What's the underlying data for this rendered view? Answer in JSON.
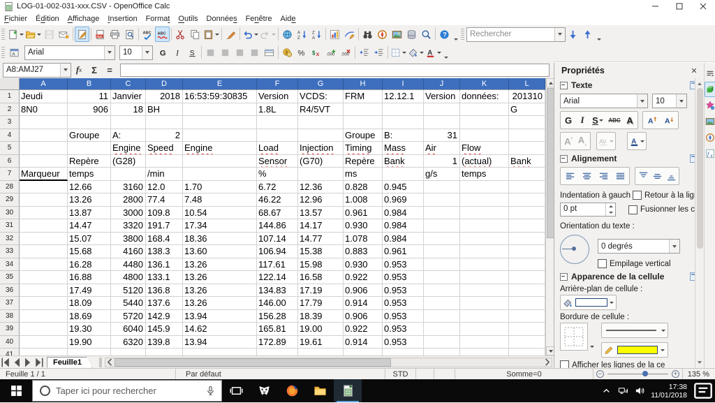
{
  "colors": {
    "column_header": "#3d6fbe",
    "toggle_highlight": "#cfe6f8",
    "taskbar_active_underline": "#63a8dc",
    "line_color_swatch": "#ffff00",
    "background_swatch": "#ffffff"
  },
  "window": {
    "title": "LOG-01-002-031-xxx.CSV - OpenOffice Calc"
  },
  "menu_bar": {
    "items": [
      {
        "label": "Fichier",
        "u": 0
      },
      {
        "label": "Édition",
        "u": 1
      },
      {
        "label": "Affichage",
        "u": 0
      },
      {
        "label": "Insertion",
        "u": 0
      },
      {
        "label": "Format",
        "u": 5
      },
      {
        "label": "Outils",
        "u": 0
      },
      {
        "label": "Données",
        "u": 6
      },
      {
        "label": "Fenêtre",
        "u": 2
      },
      {
        "label": "Aide",
        "u": 3
      }
    ]
  },
  "standard_toolbar": {
    "buttons": [
      {
        "name": "new-document",
        "dropdown": true
      },
      {
        "name": "open",
        "dropdown": true
      },
      {
        "name": "save",
        "disabled": true
      },
      {
        "name": "email"
      },
      {
        "separator": true
      },
      {
        "name": "edit-file",
        "active": true
      },
      {
        "separator": true
      },
      {
        "name": "export-pdf"
      },
      {
        "name": "print"
      },
      {
        "name": "page-preview"
      },
      {
        "separator": true
      },
      {
        "name": "spellcheck"
      },
      {
        "name": "auto-spellcheck",
        "active": true
      },
      {
        "separator": true
      },
      {
        "name": "cut"
      },
      {
        "name": "copy"
      },
      {
        "name": "paste",
        "dropdown": true
      },
      {
        "separator": true
      },
      {
        "name": "clone-formatting"
      },
      {
        "separator": true
      },
      {
        "name": "undo",
        "dropdown": true
      },
      {
        "name": "redo",
        "disabled": true,
        "dropdown": true
      },
      {
        "separator": true
      },
      {
        "name": "hyperlink"
      },
      {
        "name": "sort-ascending"
      },
      {
        "name": "sort-descending"
      },
      {
        "separator": true
      },
      {
        "name": "insert-chart"
      },
      {
        "name": "show-draw-functions"
      },
      {
        "separator": true
      },
      {
        "name": "find-and-replace"
      },
      {
        "name": "navigator"
      },
      {
        "name": "gallery"
      },
      {
        "name": "data-sources"
      },
      {
        "name": "zoom"
      },
      {
        "separator": true
      },
      {
        "name": "help"
      }
    ],
    "find": {
      "placeholder": "Rechercher",
      "value": ""
    }
  },
  "formatting_toolbar": {
    "font_name": "Arial",
    "font_size": "10",
    "buttons": [
      {
        "name": "bold"
      },
      {
        "name": "italic"
      },
      {
        "name": "underline"
      },
      {
        "separator": true
      },
      {
        "name": "align-left"
      },
      {
        "name": "align-center"
      },
      {
        "name": "align-right"
      },
      {
        "name": "align-justify"
      },
      {
        "name": "merge-cells"
      },
      {
        "separator": true
      },
      {
        "name": "currency-format"
      },
      {
        "name": "percent-format"
      },
      {
        "name": "standard-format"
      },
      {
        "name": "add-decimal"
      },
      {
        "name": "delete-decimal"
      },
      {
        "separator": true
      },
      {
        "name": "decrease-indent"
      },
      {
        "name": "increase-indent"
      },
      {
        "separator": true
      },
      {
        "name": "borders",
        "dropdown": true
      },
      {
        "name": "background-color",
        "dropdown": true
      },
      {
        "name": "font-color",
        "dropdown": true
      }
    ]
  },
  "formula_bar": {
    "name_box": "A8:AMJ27",
    "formula": ""
  },
  "grid": {
    "columns": [
      "A",
      "B",
      "C",
      "D",
      "E",
      "F",
      "G",
      "H",
      "I",
      "J",
      "K",
      "L"
    ],
    "rows": [
      {
        "n": "1",
        "cells": [
          [
            "A",
            "Jeudi",
            "l"
          ],
          [
            "B",
            "11",
            "r"
          ],
          [
            "C",
            "Janvier",
            "l"
          ],
          [
            "D",
            "2018",
            "r"
          ],
          [
            "E",
            "16:53:59:30835",
            "l"
          ],
          [
            "F",
            "Version",
            "l"
          ],
          [
            "G",
            "VCDS:",
            "l"
          ],
          [
            "H",
            "FRM",
            "l"
          ],
          [
            "I",
            "12.12.1",
            "l"
          ],
          [
            "J",
            "Version",
            "l"
          ],
          [
            "K",
            "données:",
            "l"
          ],
          [
            "L",
            "201310",
            "r"
          ]
        ]
      },
      {
        "n": "2",
        "cells": [
          [
            "A",
            "8N0",
            "l"
          ],
          [
            "B",
            "906",
            "r"
          ],
          [
            "C",
            "18",
            "r"
          ],
          [
            "D",
            "BH",
            "l"
          ],
          [
            "F",
            "1.8L",
            "l"
          ],
          [
            "G",
            "R4/5VT",
            "l"
          ],
          [
            "L",
            "G",
            "l"
          ]
        ]
      },
      {
        "n": "3",
        "cells": []
      },
      {
        "n": "4",
        "cells": [
          [
            "B",
            "Groupe",
            "l"
          ],
          [
            "C",
            "A:",
            "l"
          ],
          [
            "D",
            "2",
            "r"
          ],
          [
            "H",
            "Groupe",
            "l"
          ],
          [
            "I",
            "B:",
            "l"
          ],
          [
            "J",
            "31",
            "r"
          ]
        ]
      },
      {
        "n": "5",
        "cells": [
          [
            "C",
            "Engine",
            "l",
            1
          ],
          [
            "D",
            "Speed",
            "l",
            1
          ],
          [
            "E",
            "Engine",
            "l",
            1
          ],
          [
            "F",
            "Load",
            "l",
            1
          ],
          [
            "G",
            "Injection",
            "l",
            1
          ],
          [
            "H",
            "Timing",
            "l",
            1
          ],
          [
            "I",
            "Mass",
            "l",
            1
          ],
          [
            "J",
            "Air",
            "l",
            1
          ],
          [
            "K",
            "Flow",
            "l",
            1
          ]
        ]
      },
      {
        "n": "6",
        "cells": [
          [
            "B",
            "Repère",
            "l"
          ],
          [
            "C",
            "(G28)",
            "l"
          ],
          [
            "F",
            "Sensor",
            "l",
            1
          ],
          [
            "G",
            "(G70)",
            "l"
          ],
          [
            "H",
            "Repère",
            "l"
          ],
          [
            "I",
            "Bank",
            "l",
            1
          ],
          [
            "J",
            "1",
            "r"
          ],
          [
            "K",
            "(actual)",
            "l",
            1
          ],
          [
            "L",
            "Bank",
            "l",
            1
          ]
        ]
      },
      {
        "n": "7",
        "cells": [
          [
            "A",
            "Marqueur",
            "l"
          ],
          [
            "B",
            "temps",
            "l"
          ],
          [
            "D",
            "/min",
            "l"
          ],
          [
            "F",
            "%",
            "l"
          ],
          [
            "H",
            "ms",
            "l"
          ],
          [
            "J",
            "g/s",
            "l"
          ],
          [
            "K",
            "temps",
            "l"
          ]
        ],
        "selection_edge": "A"
      },
      {
        "n": "28",
        "cells": [
          [
            "B",
            "12.66",
            "l"
          ],
          [
            "C",
            "3160",
            "r"
          ],
          [
            "D",
            "12.0",
            "l"
          ],
          [
            "E",
            "1.70",
            "l"
          ],
          [
            "F",
            "6.72",
            "l"
          ],
          [
            "G",
            "12.36",
            "l"
          ],
          [
            "H",
            "0.828",
            "l"
          ],
          [
            "I",
            "0.945",
            "l"
          ]
        ]
      },
      {
        "n": "29",
        "cells": [
          [
            "B",
            "13.26",
            "l"
          ],
          [
            "C",
            "2800",
            "r"
          ],
          [
            "D",
            "77.4",
            "l"
          ],
          [
            "E",
            "7.48",
            "l"
          ],
          [
            "F",
            "46.22",
            "l"
          ],
          [
            "G",
            "12.96",
            "l"
          ],
          [
            "H",
            "1.008",
            "l"
          ],
          [
            "I",
            "0.969",
            "l"
          ]
        ]
      },
      {
        "n": "30",
        "cells": [
          [
            "B",
            "13.87",
            "l"
          ],
          [
            "C",
            "3000",
            "r"
          ],
          [
            "D",
            "109.8",
            "l"
          ],
          [
            "E",
            "10.54",
            "l"
          ],
          [
            "F",
            "68.67",
            "l"
          ],
          [
            "G",
            "13.57",
            "l"
          ],
          [
            "H",
            "0.961",
            "l"
          ],
          [
            "I",
            "0.984",
            "l"
          ]
        ]
      },
      {
        "n": "31",
        "cells": [
          [
            "B",
            "14.47",
            "l"
          ],
          [
            "C",
            "3320",
            "r"
          ],
          [
            "D",
            "191.7",
            "l"
          ],
          [
            "E",
            "17.34",
            "l"
          ],
          [
            "F",
            "144.86",
            "l"
          ],
          [
            "G",
            "14.17",
            "l"
          ],
          [
            "H",
            "0.930",
            "l"
          ],
          [
            "I",
            "0.984",
            "l"
          ]
        ]
      },
      {
        "n": "32",
        "cells": [
          [
            "B",
            "15.07",
            "l"
          ],
          [
            "C",
            "3800",
            "r"
          ],
          [
            "D",
            "168.4",
            "l"
          ],
          [
            "E",
            "18.36",
            "l"
          ],
          [
            "F",
            "107.14",
            "l"
          ],
          [
            "G",
            "14.77",
            "l"
          ],
          [
            "H",
            "1.078",
            "l"
          ],
          [
            "I",
            "0.984",
            "l"
          ]
        ]
      },
      {
        "n": "33",
        "cells": [
          [
            "B",
            "15.68",
            "l"
          ],
          [
            "C",
            "4160",
            "r"
          ],
          [
            "D",
            "138.3",
            "l"
          ],
          [
            "E",
            "13.60",
            "l"
          ],
          [
            "F",
            "106.94",
            "l"
          ],
          [
            "G",
            "15.38",
            "l"
          ],
          [
            "H",
            "0.883",
            "l"
          ],
          [
            "I",
            "0.961",
            "l"
          ]
        ]
      },
      {
        "n": "34",
        "cells": [
          [
            "B",
            "16.28",
            "l"
          ],
          [
            "C",
            "4480",
            "r"
          ],
          [
            "D",
            "136.1",
            "l"
          ],
          [
            "E",
            "13.26",
            "l"
          ],
          [
            "F",
            "117.61",
            "l"
          ],
          [
            "G",
            "15.98",
            "l"
          ],
          [
            "H",
            "0.930",
            "l"
          ],
          [
            "I",
            "0.953",
            "l"
          ]
        ]
      },
      {
        "n": "35",
        "cells": [
          [
            "B",
            "16.88",
            "l"
          ],
          [
            "C",
            "4800",
            "r"
          ],
          [
            "D",
            "133.1",
            "l"
          ],
          [
            "E",
            "13.26",
            "l"
          ],
          [
            "F",
            "122.14",
            "l"
          ],
          [
            "G",
            "16.58",
            "l"
          ],
          [
            "H",
            "0.922",
            "l"
          ],
          [
            "I",
            "0.953",
            "l"
          ]
        ]
      },
      {
        "n": "36",
        "cells": [
          [
            "B",
            "17.49",
            "l"
          ],
          [
            "C",
            "5120",
            "r"
          ],
          [
            "D",
            "136.8",
            "l"
          ],
          [
            "E",
            "13.26",
            "l"
          ],
          [
            "F",
            "134.83",
            "l"
          ],
          [
            "G",
            "17.19",
            "l"
          ],
          [
            "H",
            "0.906",
            "l"
          ],
          [
            "I",
            "0.953",
            "l"
          ]
        ]
      },
      {
        "n": "37",
        "cells": [
          [
            "B",
            "18.09",
            "l"
          ],
          [
            "C",
            "5440",
            "r"
          ],
          [
            "D",
            "137.6",
            "l"
          ],
          [
            "E",
            "13.26",
            "l"
          ],
          [
            "F",
            "146.00",
            "l"
          ],
          [
            "G",
            "17.79",
            "l"
          ],
          [
            "H",
            "0.914",
            "l"
          ],
          [
            "I",
            "0.953",
            "l"
          ]
        ]
      },
      {
        "n": "38",
        "cells": [
          [
            "B",
            "18.69",
            "l"
          ],
          [
            "C",
            "5720",
            "r"
          ],
          [
            "D",
            "142.9",
            "l"
          ],
          [
            "E",
            "13.94",
            "l"
          ],
          [
            "F",
            "156.28",
            "l"
          ],
          [
            "G",
            "18.39",
            "l"
          ],
          [
            "H",
            "0.906",
            "l"
          ],
          [
            "I",
            "0.953",
            "l"
          ]
        ]
      },
      {
        "n": "39",
        "cells": [
          [
            "B",
            "19.30",
            "l"
          ],
          [
            "C",
            "6040",
            "r"
          ],
          [
            "D",
            "145.9",
            "l"
          ],
          [
            "E",
            "14.62",
            "l"
          ],
          [
            "F",
            "165.81",
            "l"
          ],
          [
            "G",
            "19.00",
            "l"
          ],
          [
            "H",
            "0.922",
            "l"
          ],
          [
            "I",
            "0.953",
            "l"
          ]
        ]
      },
      {
        "n": "40",
        "cells": [
          [
            "B",
            "19.90",
            "l"
          ],
          [
            "C",
            "6320",
            "r"
          ],
          [
            "D",
            "139.8",
            "l"
          ],
          [
            "E",
            "13.94",
            "l"
          ],
          [
            "F",
            "172.89",
            "l"
          ],
          [
            "G",
            "19.61",
            "l"
          ],
          [
            "H",
            "0.914",
            "l"
          ],
          [
            "I",
            "0.953",
            "l"
          ]
        ]
      },
      {
        "n": "41",
        "cells": []
      }
    ]
  },
  "sheet_tabs": {
    "active": "Feuille1"
  },
  "status_bar": {
    "sheet_position": "Feuille 1 / 1",
    "page_style": "Par défaut",
    "insert_mode": "STD",
    "selection_sum": "Somme=0",
    "zoom_level": "135 %"
  },
  "sidebar": {
    "title": "Propriétés",
    "tabs": [
      {
        "name": "sidebar-menu"
      },
      {
        "name": "properties-deck",
        "active": true
      },
      {
        "name": "styles-deck"
      },
      {
        "name": "gallery-deck"
      },
      {
        "name": "navigator-deck"
      },
      {
        "name": "functions-deck"
      }
    ],
    "sections": {
      "texte": {
        "title": "Texte",
        "font_name": "Arial",
        "font_size": "10"
      },
      "alignement": {
        "title": "Alignement",
        "indent_label": "Indentation à gauch",
        "indent_value": "0 pt",
        "wrap_label": "Retour à la ligr",
        "merge_label": "Fusionner les c",
        "orientation_label": "Orientation du texte :",
        "orientation_value": "0 degrés",
        "stack_label": "Empilage vertical"
      },
      "apparence": {
        "title": "Apparence de la cellule",
        "background_label": "Arrière-plan de cellule :",
        "border_label": "Bordure de cellule :",
        "clipped_label": "Afficher les lignes de la ce"
      }
    }
  },
  "taskbar": {
    "search_placeholder": "Taper ici pour rechercher",
    "apps": [
      {
        "name": "task-view"
      },
      {
        "name": "mask-app"
      },
      {
        "name": "firefox"
      },
      {
        "name": "file-explorer"
      },
      {
        "name": "openoffice-calc",
        "active": true
      }
    ],
    "clock": {
      "time": "17:38",
      "date": "11/01/2018"
    }
  }
}
